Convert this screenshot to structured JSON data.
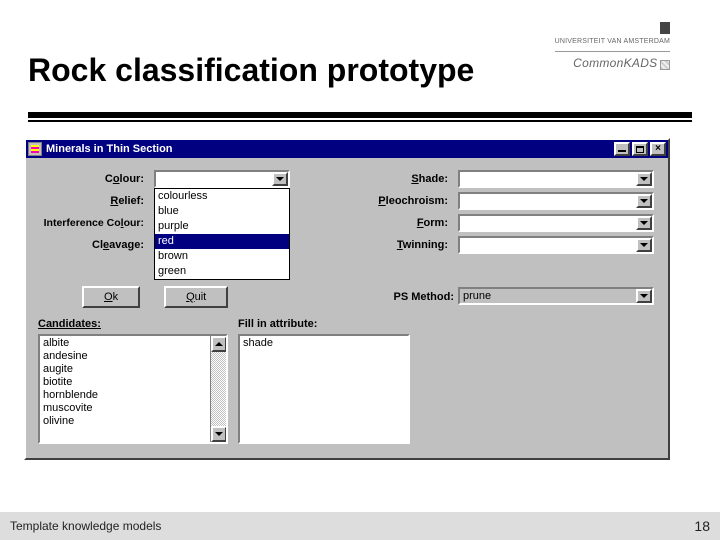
{
  "header": {
    "uni_text": "UNIVERSITEIT VAN AMSTERDAM",
    "ck_text": "CommonKADS"
  },
  "slide_title": "Rock classification prototype",
  "window": {
    "title": "Minerals in Thin Section",
    "controls": {
      "min": "_",
      "max": "□",
      "close": "×"
    },
    "left_labels": {
      "colour_pre": "C",
      "colour_ul": "o",
      "colour_post": "lour:",
      "relief_ul": "R",
      "relief_post": "elief:",
      "interf_pre": "Interference Co",
      "interf_ul": "l",
      "interf_post": "our:",
      "cleav_pre": "Cl",
      "cleav_ul": "e",
      "cleav_post": "avage:"
    },
    "right_labels": {
      "shade_ul": "S",
      "shade_post": "hade:",
      "pleo_ul": "P",
      "pleo_post": "leochroism:",
      "form_ul": "F",
      "form_post": "orm:",
      "twin_ul": "T",
      "twin_post": "winning:"
    },
    "colour_options": [
      "colourless",
      "blue",
      "purple",
      "red",
      "brown",
      "green"
    ],
    "colour_selected": "red",
    "buttons": {
      "ok_ul": "O",
      "ok_post": "k",
      "quit_ul": "Q",
      "quit_post": "uit"
    },
    "ps_label": "PS Method:",
    "ps_value": "prune",
    "candidates_label": "Candidates:",
    "fill_label": "Fill in attribute:",
    "candidates": [
      "albite",
      "andesine",
      "augite",
      "biotite",
      "hornblende",
      "muscovite",
      "olivine"
    ],
    "fill_items": [
      "shade"
    ]
  },
  "footer": {
    "left": "Template knowledge models",
    "page": "18"
  }
}
